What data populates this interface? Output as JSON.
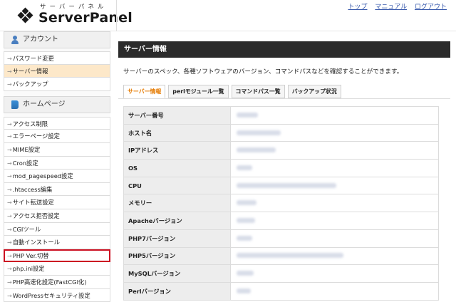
{
  "logo": {
    "sub": "サーバーパネル",
    "main": "ServerPanel"
  },
  "topnav": [
    "トップ",
    "マニュアル",
    "ログアウト"
  ],
  "sidebar": {
    "account_title": "アカウント",
    "account_items": [
      "パスワード変更",
      "サーバー情報",
      "バックアップ"
    ],
    "home_title": "ホームページ",
    "home_items": [
      "アクセス制限",
      "エラーページ設定",
      "MIME設定",
      "Cron設定",
      "mod_pagespeed設定",
      ".htaccess編集",
      "サイト転送設定",
      "アクセス拒否設定",
      "CGIツール",
      "自動インストール",
      "PHP Ver.切替",
      "php.ini設定",
      "PHP高速化設定(FastCGI化)",
      "WordPressセキュリティ設定"
    ]
  },
  "main": {
    "title": "サーバー情報",
    "description": "サーバーのスペック、各種ソフトウェアのバージョン、コマンドパスなどを確認することができます。",
    "tabs": [
      "サーバー情報",
      "perlモジュール一覧",
      "コマンドパス一覧",
      "バックアップ状況"
    ],
    "rows": [
      "サーバー番号",
      "ホスト名",
      "IPアドレス",
      "OS",
      "CPU",
      "メモリー",
      "Apacheバージョン",
      "PHP7バージョン",
      "PHP5バージョン",
      "MySQLバージョン",
      "Perlバージョン"
    ]
  },
  "colors": {
    "accent": "#e57a00",
    "highlight": "#cc1122",
    "active_bg": "#fde8c9",
    "title_bar": "#2b2b2b"
  }
}
